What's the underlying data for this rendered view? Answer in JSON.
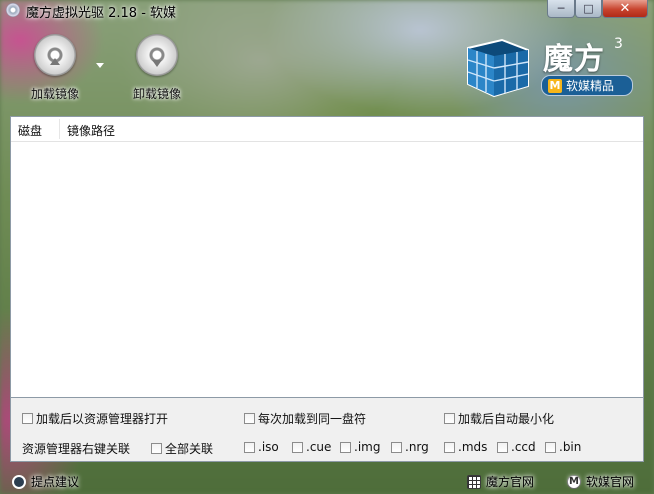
{
  "window": {
    "title": "魔方虚拟光驱 2.18 - 软媒",
    "minimize": "─",
    "maximize": "□",
    "close": "✕"
  },
  "toolbar": {
    "mount_label": "加载镜像",
    "unmount_label": "卸载镜像"
  },
  "logo": {
    "name": "魔方",
    "superscript": "3",
    "badge_mark": "M",
    "badge_text": "软媒精品"
  },
  "table": {
    "columns": [
      "磁盘",
      "镜像路径"
    ],
    "rows": []
  },
  "options": {
    "open_in_explorer": "加载后以资源管理器打开",
    "same_drive_letter": "每次加载到同一盘符",
    "minimize_after_mount": "加载后自动最小化",
    "context_menu_label": "资源管理器右键关联",
    "associate_all": "全部关联",
    "extensions": [
      ".iso",
      ".cue",
      ".img",
      ".nrg",
      ".mds",
      ".ccd",
      ".bin"
    ]
  },
  "status": {
    "feedback": "提点建议",
    "mofang_site": "魔方官网",
    "ruanmei_site": "软媒官网"
  },
  "icons": {
    "app": "cd-icon",
    "mount": "disc-eject-icon",
    "unmount": "disc-download-icon",
    "feedback": "hint-icon",
    "mofang": "grid-icon",
    "ruanmei": "m-logo-icon"
  }
}
